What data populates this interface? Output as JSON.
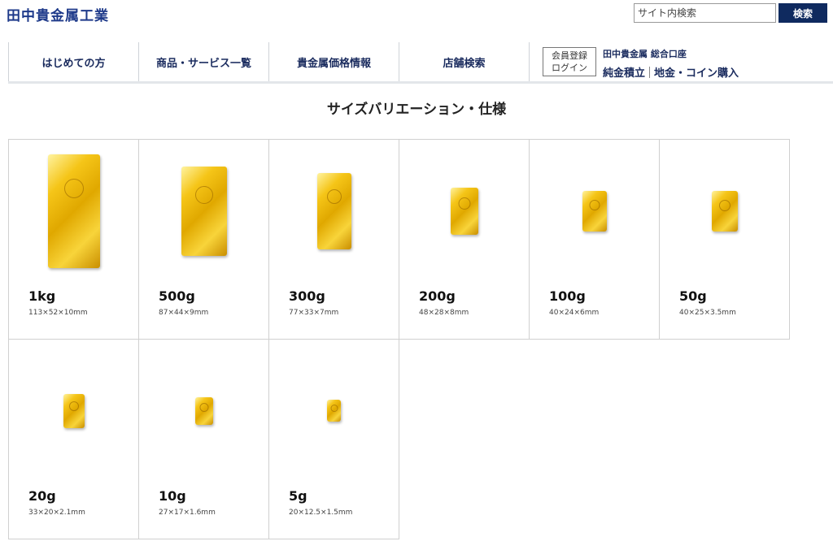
{
  "header": {
    "logo": "田中貴金属工業",
    "search_placeholder": "サイト内検索",
    "search_button": "検索"
  },
  "nav": {
    "items": [
      {
        "label": "はじめての方"
      },
      {
        "label": "商品・サービス一覧"
      },
      {
        "label": "貴金属価格情報"
      },
      {
        "label": "店舗検索"
      }
    ],
    "member_register": "会員登録",
    "login": "ログイン",
    "account_title": "田中貴金属 総合口座",
    "link_saving": "純金積立",
    "link_coin": "地金・コイン購入"
  },
  "section": {
    "title": "サイズバリエーション・仕様"
  },
  "products": [
    {
      "weight": "1kg",
      "dims": "113×52×10mm"
    },
    {
      "weight": "500g",
      "dims": "87×44×9mm"
    },
    {
      "weight": "300g",
      "dims": "77×33×7mm"
    },
    {
      "weight": "200g",
      "dims": "48×28×8mm"
    },
    {
      "weight": "100g",
      "dims": "40×24×6mm"
    },
    {
      "weight": "50g",
      "dims": "40×25×3.5mm"
    },
    {
      "weight": "20g",
      "dims": "33×20×2.1mm"
    },
    {
      "weight": "10g",
      "dims": "27×17×1.6mm"
    },
    {
      "weight": "5g",
      "dims": "20×12.5×1.5mm"
    }
  ],
  "colors": {
    "brand": "#1e3a8a",
    "nav_text": "#1a2b5e",
    "search_button_bg": "#0f2a5f",
    "gold": "#e0a800"
  }
}
